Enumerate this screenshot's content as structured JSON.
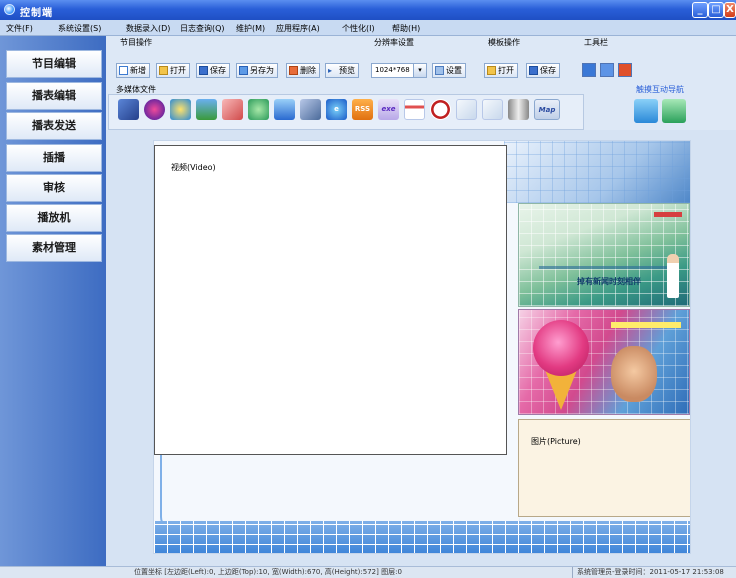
{
  "window": {
    "title": "控制端",
    "min": "_",
    "max": "□",
    "close": "X"
  },
  "menu": [
    "文件(F)",
    "系统设置(S)",
    "数据录入(D)",
    "日志查询(Q)",
    "维护(M)",
    "应用程序(A)",
    "个性化(I)",
    "帮助(H)"
  ],
  "nav": [
    "节目编辑",
    "播表编辑",
    "播表发送",
    "插播",
    "审核",
    "播放机",
    "素材管理"
  ],
  "toolbar": {
    "program_ops_label": "节目操作",
    "new": "新增",
    "open": "打开",
    "save": "保存",
    "saveas": "另存为",
    "delete": "删除",
    "preview": "预览",
    "resolution_label": "分辨率设置",
    "resolution_value": "1024*768",
    "resolution_arrow": "▾",
    "settings": "设置",
    "template_ops_label": "模板操作",
    "tpl_open": "打开",
    "tpl_save": "保存",
    "toolbox_label": "工具栏",
    "media_label": "多媒体文件",
    "media_rss": "RSS",
    "media_exe": "exe",
    "media_map": "Map",
    "touch_label": "触摸互动导航"
  },
  "stage": {
    "video_label": "视频(Video)",
    "picture_label": "图片(Picture)",
    "pic1_caption": "掉有新闻时刻相伴"
  },
  "status": {
    "position": "位置坐标 [左边距(Left):0, 上边距(Top):10, 宽(Width):670, 高(Height):572] 图层:0",
    "user": "系统管理员-登录时间：2011-05-17 21:53:08"
  },
  "colors": {
    "titlebar": "#2a5fd8",
    "nav_bg": "#3d6cc2",
    "accent_blue": "#7fb0e8"
  }
}
